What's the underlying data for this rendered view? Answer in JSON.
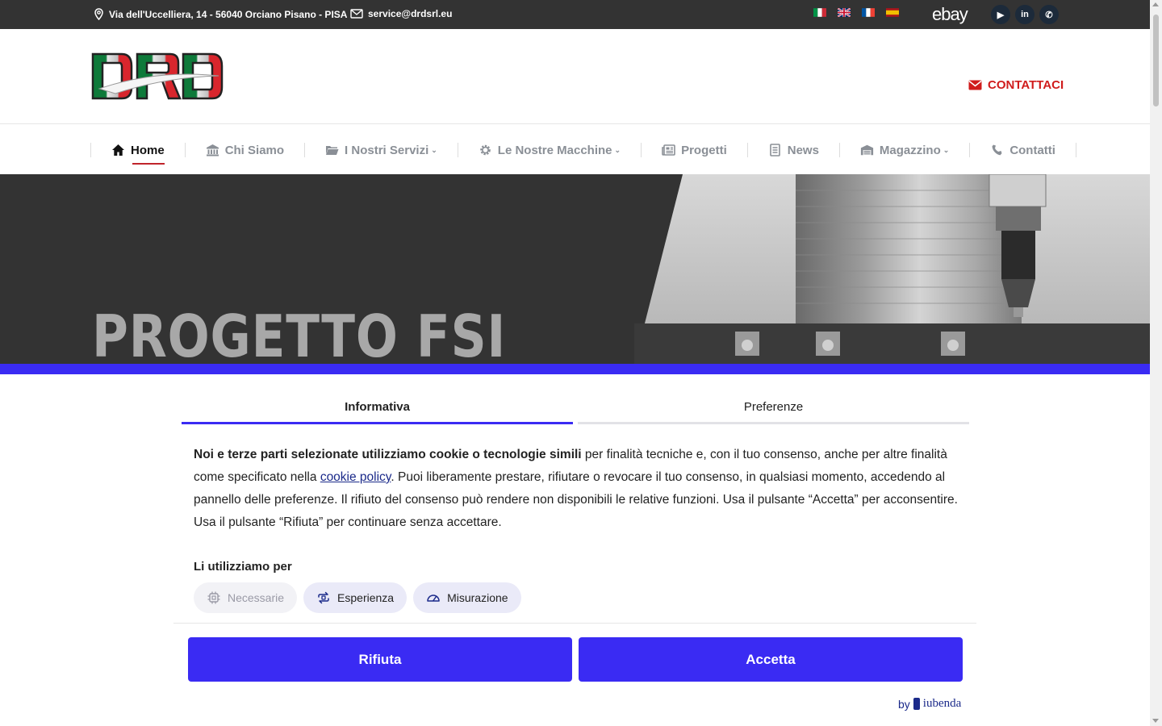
{
  "topbar": {
    "address": "Via dell'Uccelliera, 14 - 56040 Orciano Pisano - PISA",
    "email": "service@drdsrl.eu",
    "flags": [
      "flag-it-icon",
      "flag-uk-icon",
      "flag-fr-icon",
      "flag-es-icon"
    ],
    "ebay": "ebay",
    "socials": [
      {
        "name": "youtube-icon",
        "glyph": "▶"
      },
      {
        "name": "linkedin-icon",
        "glyph": "in"
      },
      {
        "name": "whatsapp-icon",
        "glyph": "✆"
      }
    ]
  },
  "header": {
    "logo_text": "DRD",
    "contact_label": "CONTATTACI"
  },
  "nav": {
    "items": [
      {
        "label": "Home",
        "icon": "home-icon",
        "active": true
      },
      {
        "label": "Chi Siamo",
        "icon": "bank-icon"
      },
      {
        "label": "I Nostri Servizi",
        "icon": "folder-icon",
        "dropdown": true
      },
      {
        "label": "Le Nostre Macchine",
        "icon": "gear-icon",
        "dropdown": true
      },
      {
        "label": "Progetti",
        "icon": "newspaper-icon"
      },
      {
        "label": "News",
        "icon": "document-icon"
      },
      {
        "label": "Magazzino",
        "icon": "warehouse-icon",
        "dropdown": true
      },
      {
        "label": "Contatti",
        "icon": "phone-icon"
      }
    ]
  },
  "hero": {
    "title": "PROGETTO FSI"
  },
  "cookie": {
    "tabs": [
      "Informativa",
      "Preferenze"
    ],
    "text_bold": "Noi e terze parti selezionate utilizziamo cookie o tecnologie simili",
    "text_1": " per finalità tecniche e, con il tuo consenso, anche per altre finalità come specificato nella ",
    "link": "cookie policy",
    "text_2": ". Puoi liberamente prestare, rifiutare o revocare il tuo consenso, in qualsiasi momento, accedendo al pannello delle preferenze. Il rifiuto del consenso può rendere non disponibili le relative funzioni. Usa il pulsante “Accetta” per acconsentire. Usa il pulsante “Rifiuta” per continuare senza accettare.",
    "use_label": "Li utilizziamo per",
    "chips": [
      "Necessarie",
      "Esperienza",
      "Misurazione"
    ],
    "reject_label": "Rifiuta",
    "accept_label": "Accetta",
    "by_label": "by",
    "brand": "iubenda"
  },
  "colors": {
    "accent": "#3a2bf3",
    "topbar": "#333333",
    "cta_red": "#d01c1c",
    "nav_active_underline": "#c0242b"
  }
}
